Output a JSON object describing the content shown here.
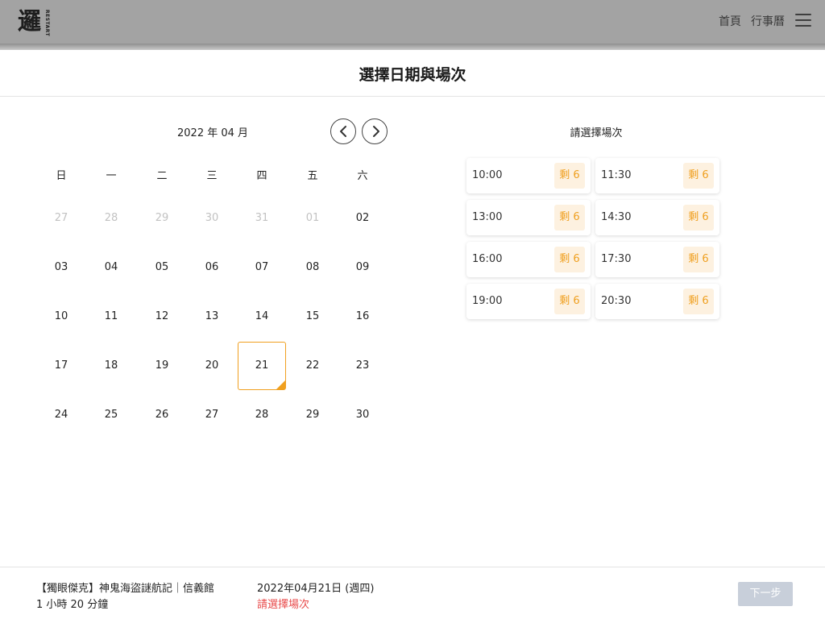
{
  "header": {
    "logo_text": "邏",
    "logo_sub": "RESTART",
    "nav_home": "首頁",
    "nav_calendar": "行事曆",
    "menu_icon": "hamburger-icon"
  },
  "page": {
    "title": "選擇日期與場次"
  },
  "calendar": {
    "month_label": "2022 年 04 月",
    "weekdays": [
      "日",
      "一",
      "二",
      "三",
      "四",
      "五",
      "六"
    ],
    "days": [
      "27",
      "28",
      "29",
      "30",
      "31",
      "01",
      "02",
      "03",
      "04",
      "05",
      "06",
      "07",
      "08",
      "09",
      "10",
      "11",
      "12",
      "13",
      "14",
      "15",
      "16",
      "17",
      "18",
      "19",
      "20",
      "21",
      "22",
      "23",
      "24",
      "25",
      "26",
      "27",
      "28",
      "29",
      "30"
    ],
    "muted_days_count": 6,
    "selected_day": "21",
    "prev_icon": "chevron-left-icon",
    "next_icon": "chevron-right-icon"
  },
  "sessions": {
    "title": "請選擇場次",
    "slots": [
      {
        "time": "10:00",
        "badge": "剩 6"
      },
      {
        "time": "11:30",
        "badge": "剩 6"
      },
      {
        "time": "13:00",
        "badge": "剩 6"
      },
      {
        "time": "14:30",
        "badge": "剩 6"
      },
      {
        "time": "16:00",
        "badge": "剩 6"
      },
      {
        "time": "17:30",
        "badge": "剩 6"
      },
      {
        "time": "19:00",
        "badge": "剩 6"
      },
      {
        "time": "20:30",
        "badge": "剩 6"
      }
    ]
  },
  "footer": {
    "room_name": "【獨眼傑克】神鬼海盜謎航記｜信義館",
    "duration": "1 小時 20 分鐘",
    "selected_date": "2022年04月21日 (週四)",
    "warning": "請選擇場次",
    "next_label": "下一步"
  },
  "colors": {
    "accent": "#f0a020",
    "badge_bg": "#fdf1e0",
    "warning": "#e84a4a",
    "disabled_button": "#c8cfda"
  }
}
